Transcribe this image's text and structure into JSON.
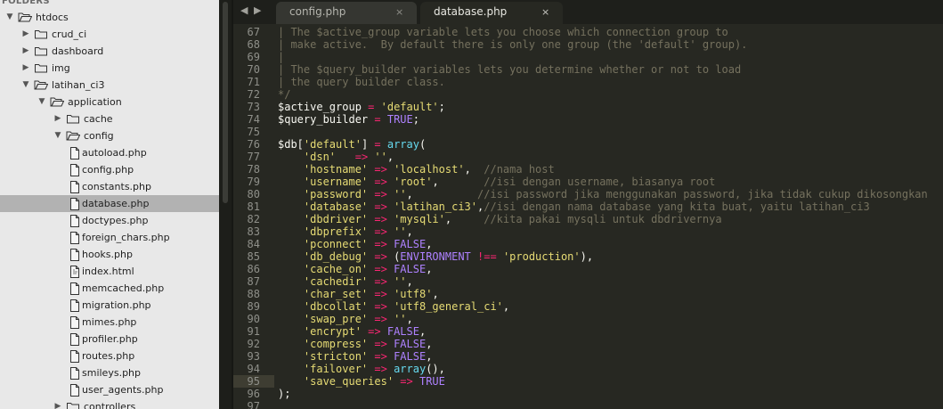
{
  "sidebar": {
    "header": "FOLDERS",
    "items": [
      {
        "label": "htdocs",
        "type": "folder",
        "open": true
      },
      {
        "label": "crud_ci",
        "type": "folder",
        "open": false
      },
      {
        "label": "dashboard",
        "type": "folder",
        "open": false
      },
      {
        "label": "img",
        "type": "folder",
        "open": false
      },
      {
        "label": "latihan_ci3",
        "type": "folder",
        "open": true
      },
      {
        "label": "application",
        "type": "folder",
        "open": true
      },
      {
        "label": "cache",
        "type": "folder",
        "open": false
      },
      {
        "label": "config",
        "type": "folder",
        "open": true
      },
      {
        "label": "autoload.php",
        "type": "file"
      },
      {
        "label": "config.php",
        "type": "file"
      },
      {
        "label": "constants.php",
        "type": "file"
      },
      {
        "label": "database.php",
        "type": "file",
        "selected": true
      },
      {
        "label": "doctypes.php",
        "type": "file"
      },
      {
        "label": "foreign_chars.php",
        "type": "file"
      },
      {
        "label": "hooks.php",
        "type": "file"
      },
      {
        "label": "index.html",
        "type": "file-html"
      },
      {
        "label": "memcached.php",
        "type": "file"
      },
      {
        "label": "migration.php",
        "type": "file"
      },
      {
        "label": "mimes.php",
        "type": "file"
      },
      {
        "label": "profiler.php",
        "type": "file"
      },
      {
        "label": "routes.php",
        "type": "file"
      },
      {
        "label": "smileys.php",
        "type": "file"
      },
      {
        "label": "user_agents.php",
        "type": "file"
      },
      {
        "label": "controllers",
        "type": "folder",
        "open": false
      }
    ]
  },
  "tabs": [
    {
      "label": "config.php",
      "active": false,
      "close": "×"
    },
    {
      "label": "database.php",
      "active": true,
      "close": "×"
    }
  ],
  "nav": {
    "back": "◀",
    "forward": "▶"
  },
  "editor": {
    "highlighted_line": 95,
    "lines": [
      {
        "n": "67",
        "segs": [
          [
            "c",
            "| The $active_group variable lets you choose which connection group to"
          ]
        ]
      },
      {
        "n": "68",
        "segs": [
          [
            "c",
            "| make active.  By default there is only one group (the 'default' group)."
          ]
        ]
      },
      {
        "n": "69",
        "segs": [
          [
            "c",
            "|"
          ]
        ]
      },
      {
        "n": "70",
        "segs": [
          [
            "c",
            "| The $query_builder variables lets you determine whether or not to load"
          ]
        ]
      },
      {
        "n": "71",
        "segs": [
          [
            "c",
            "| the query builder class."
          ]
        ]
      },
      {
        "n": "72",
        "segs": [
          [
            "c",
            "*/"
          ]
        ]
      },
      {
        "n": "73",
        "segs": [
          [
            "v",
            "$active_group "
          ],
          [
            "o",
            "="
          ],
          [
            "v",
            " "
          ],
          [
            "s",
            "'default'"
          ],
          [
            "v",
            ";"
          ]
        ]
      },
      {
        "n": "74",
        "segs": [
          [
            "v",
            "$query_builder "
          ],
          [
            "o",
            "="
          ],
          [
            "v",
            " "
          ],
          [
            "k",
            "TRUE"
          ],
          [
            "v",
            ";"
          ]
        ]
      },
      {
        "n": "75",
        "segs": []
      },
      {
        "n": "76",
        "segs": [
          [
            "v",
            "$db["
          ],
          [
            "s",
            "'default'"
          ],
          [
            "v",
            "] "
          ],
          [
            "o",
            "="
          ],
          [
            "v",
            " "
          ],
          [
            "f",
            "array"
          ],
          [
            "v",
            "("
          ]
        ]
      },
      {
        "n": "77",
        "segs": [
          [
            "v",
            "    "
          ],
          [
            "s",
            "'dsn'"
          ],
          [
            "v",
            "   "
          ],
          [
            "o",
            "=>"
          ],
          [
            "v",
            " "
          ],
          [
            "s",
            "''"
          ],
          [
            "v",
            ","
          ]
        ]
      },
      {
        "n": "78",
        "segs": [
          [
            "v",
            "    "
          ],
          [
            "s",
            "'hostname'"
          ],
          [
            "v",
            " "
          ],
          [
            "o",
            "=>"
          ],
          [
            "v",
            " "
          ],
          [
            "s",
            "'localhost'"
          ],
          [
            "v",
            ",  "
          ],
          [
            "c",
            "//nama host"
          ]
        ]
      },
      {
        "n": "79",
        "segs": [
          [
            "v",
            "    "
          ],
          [
            "s",
            "'username'"
          ],
          [
            "v",
            " "
          ],
          [
            "o",
            "=>"
          ],
          [
            "v",
            " "
          ],
          [
            "s",
            "'root'"
          ],
          [
            "v",
            ",       "
          ],
          [
            "c",
            "//isi dengan username, biasanya root"
          ]
        ]
      },
      {
        "n": "80",
        "segs": [
          [
            "v",
            "    "
          ],
          [
            "s",
            "'password'"
          ],
          [
            "v",
            " "
          ],
          [
            "o",
            "=>"
          ],
          [
            "v",
            " "
          ],
          [
            "s",
            "''"
          ],
          [
            "v",
            ",          "
          ],
          [
            "c",
            "//isi password jika menggunakan password, jika tidak cukup dikosongkan"
          ]
        ]
      },
      {
        "n": "81",
        "segs": [
          [
            "v",
            "    "
          ],
          [
            "s",
            "'database'"
          ],
          [
            "v",
            " "
          ],
          [
            "o",
            "=>"
          ],
          [
            "v",
            " "
          ],
          [
            "s",
            "'latihan_ci3'"
          ],
          [
            "v",
            ","
          ],
          [
            "c",
            "//isi dengan nama database yang kita buat, yaitu latihan_ci3"
          ]
        ]
      },
      {
        "n": "82",
        "segs": [
          [
            "v",
            "    "
          ],
          [
            "s",
            "'dbdriver'"
          ],
          [
            "v",
            " "
          ],
          [
            "o",
            "=>"
          ],
          [
            "v",
            " "
          ],
          [
            "s",
            "'mysqli'"
          ],
          [
            "v",
            ",     "
          ],
          [
            "c",
            "//kita pakai mysqli untuk dbdrivernya"
          ]
        ]
      },
      {
        "n": "83",
        "segs": [
          [
            "v",
            "    "
          ],
          [
            "s",
            "'dbprefix'"
          ],
          [
            "v",
            " "
          ],
          [
            "o",
            "=>"
          ],
          [
            "v",
            " "
          ],
          [
            "s",
            "''"
          ],
          [
            "v",
            ","
          ]
        ]
      },
      {
        "n": "84",
        "segs": [
          [
            "v",
            "    "
          ],
          [
            "s",
            "'pconnect'"
          ],
          [
            "v",
            " "
          ],
          [
            "o",
            "=>"
          ],
          [
            "v",
            " "
          ],
          [
            "k",
            "FALSE"
          ],
          [
            "v",
            ","
          ]
        ]
      },
      {
        "n": "85",
        "segs": [
          [
            "v",
            "    "
          ],
          [
            "s",
            "'db_debug'"
          ],
          [
            "v",
            " "
          ],
          [
            "o",
            "=>"
          ],
          [
            "v",
            " ("
          ],
          [
            "k",
            "ENVIRONMENT"
          ],
          [
            "v",
            " "
          ],
          [
            "o",
            "!=="
          ],
          [
            "v",
            " "
          ],
          [
            "s",
            "'production'"
          ],
          [
            "v",
            "),"
          ]
        ]
      },
      {
        "n": "86",
        "segs": [
          [
            "v",
            "    "
          ],
          [
            "s",
            "'cache_on'"
          ],
          [
            "v",
            " "
          ],
          [
            "o",
            "=>"
          ],
          [
            "v",
            " "
          ],
          [
            "k",
            "FALSE"
          ],
          [
            "v",
            ","
          ]
        ]
      },
      {
        "n": "87",
        "segs": [
          [
            "v",
            "    "
          ],
          [
            "s",
            "'cachedir'"
          ],
          [
            "v",
            " "
          ],
          [
            "o",
            "=>"
          ],
          [
            "v",
            " "
          ],
          [
            "s",
            "''"
          ],
          [
            "v",
            ","
          ]
        ]
      },
      {
        "n": "88",
        "segs": [
          [
            "v",
            "    "
          ],
          [
            "s",
            "'char_set'"
          ],
          [
            "v",
            " "
          ],
          [
            "o",
            "=>"
          ],
          [
            "v",
            " "
          ],
          [
            "s",
            "'utf8'"
          ],
          [
            "v",
            ","
          ]
        ]
      },
      {
        "n": "89",
        "segs": [
          [
            "v",
            "    "
          ],
          [
            "s",
            "'dbcollat'"
          ],
          [
            "v",
            " "
          ],
          [
            "o",
            "=>"
          ],
          [
            "v",
            " "
          ],
          [
            "s",
            "'utf8_general_ci'"
          ],
          [
            "v",
            ","
          ]
        ]
      },
      {
        "n": "90",
        "segs": [
          [
            "v",
            "    "
          ],
          [
            "s",
            "'swap_pre'"
          ],
          [
            "v",
            " "
          ],
          [
            "o",
            "=>"
          ],
          [
            "v",
            " "
          ],
          [
            "s",
            "''"
          ],
          [
            "v",
            ","
          ]
        ]
      },
      {
        "n": "91",
        "segs": [
          [
            "v",
            "    "
          ],
          [
            "s",
            "'encrypt'"
          ],
          [
            "v",
            " "
          ],
          [
            "o",
            "=>"
          ],
          [
            "v",
            " "
          ],
          [
            "k",
            "FALSE"
          ],
          [
            "v",
            ","
          ]
        ]
      },
      {
        "n": "92",
        "segs": [
          [
            "v",
            "    "
          ],
          [
            "s",
            "'compress'"
          ],
          [
            "v",
            " "
          ],
          [
            "o",
            "=>"
          ],
          [
            "v",
            " "
          ],
          [
            "k",
            "FALSE"
          ],
          [
            "v",
            ","
          ]
        ]
      },
      {
        "n": "93",
        "segs": [
          [
            "v",
            "    "
          ],
          [
            "s",
            "'stricton'"
          ],
          [
            "v",
            " "
          ],
          [
            "o",
            "=>"
          ],
          [
            "v",
            " "
          ],
          [
            "k",
            "FALSE"
          ],
          [
            "v",
            ","
          ]
        ]
      },
      {
        "n": "94",
        "segs": [
          [
            "v",
            "    "
          ],
          [
            "s",
            "'failover'"
          ],
          [
            "v",
            " "
          ],
          [
            "o",
            "=>"
          ],
          [
            "v",
            " "
          ],
          [
            "f",
            "array"
          ],
          [
            "v",
            "(),"
          ]
        ]
      },
      {
        "n": "95",
        "segs": [
          [
            "v",
            "    "
          ],
          [
            "s",
            "'save_queries'"
          ],
          [
            "v",
            " "
          ],
          [
            "o",
            "=>"
          ],
          [
            "v",
            " "
          ],
          [
            "k",
            "TRUE"
          ]
        ]
      },
      {
        "n": "96",
        "segs": [
          [
            "v",
            ");"
          ]
        ]
      },
      {
        "n": "97",
        "segs": []
      }
    ]
  }
}
